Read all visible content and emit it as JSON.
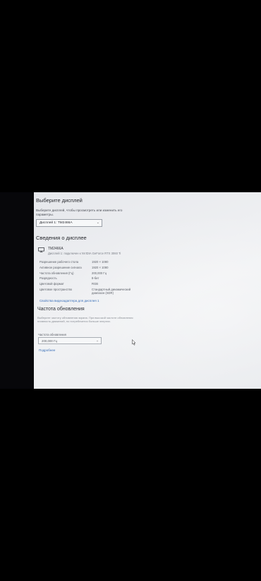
{
  "display_select": {
    "title": "Выберите дисплей",
    "description": "Выберите дисплей, чтобы просмотреть или изменить его параметры.",
    "selected_value": "Дисплей 1: TM2466A"
  },
  "display_info": {
    "title": "Сведения о дисплее",
    "monitor_name": "TM2466A",
    "monitor_subtitle": "Дисплей 1: подключен к NVIDIA GeForce RTX 3060 Ti",
    "properties": [
      {
        "key": "Разрешение рабочего стола",
        "value": "1920 × 1080"
      },
      {
        "key": "Активное разрешение сигнала",
        "value": "1920 × 1080"
      },
      {
        "key": "Частота обновления (Гц)",
        "value": "200,000 Гц"
      },
      {
        "key": "Разрядность",
        "value": "8-бит"
      },
      {
        "key": "Цветовой формат",
        "value": "RGB"
      },
      {
        "key": "Цветовое пространство",
        "value": "Стандартный динамический диапазон (SDR)"
      }
    ],
    "adapter_link": "Свойства видеоадаптера для дисплея 1"
  },
  "refresh": {
    "title": "Частота обновления",
    "description": "Выберите частоту обновления экрана. При высокой частоте обновления плавность движений, но потребляется больше энергии.",
    "rate_label": "Частота обновления",
    "rate_value": "200,000 Гц",
    "more_link": "Подробнее"
  },
  "icons": {
    "monitor": "monitor-icon",
    "chevron": "chevron-down-icon",
    "cursor": "mouse-cursor-icon"
  }
}
